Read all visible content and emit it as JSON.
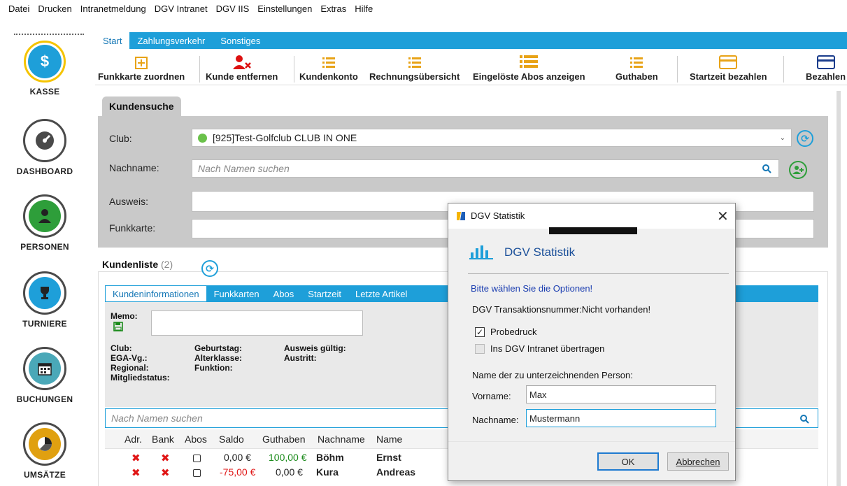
{
  "menu": [
    "Datei",
    "Drucken",
    "Intranetmeldung",
    "DGV Intranet",
    "DGV IIS",
    "Einstellungen",
    "Extras",
    "Hilfe"
  ],
  "sidebar": [
    {
      "label": "KASSE",
      "icon": "dollar-icon",
      "symbol": "$",
      "color": "#1e9fd9",
      "ring": "#f5c400"
    },
    {
      "label": "DASHBOARD",
      "icon": "dashboard-gauge-icon",
      "symbol": "◕",
      "color": "#4a4a4a",
      "ring": "#4a4a4a"
    },
    {
      "label": "PERSONEN",
      "icon": "person-icon",
      "symbol": "●",
      "color": "#2e9e3a",
      "ring": "#4a4a4a"
    },
    {
      "label": "TURNIERE",
      "icon": "trophy-icon",
      "symbol": "🏆",
      "color": "#1e9fd9",
      "ring": "#4a4a4a"
    },
    {
      "label": "BUCHUNGEN",
      "icon": "calendar-icon",
      "symbol": "▦",
      "color": "#4aa8b8",
      "ring": "#4a4a4a"
    },
    {
      "label": "UMSÄTZE",
      "icon": "pie-chart-icon",
      "symbol": "◔",
      "color": "#e0a010",
      "ring": "#4a4a4a"
    }
  ],
  "tabs": [
    "Start",
    "Zahlungsverkehr",
    "Sonstiges"
  ],
  "toolbar": [
    {
      "label": "Funkkarte zuordnen",
      "icon": "plus-box-icon"
    },
    {
      "label": "Kunde entfernen",
      "icon": "remove-user-icon"
    },
    {
      "label": "Kundenkonto",
      "icon": "list-icon"
    },
    {
      "label": "Rechnungsübersicht",
      "icon": "list-icon"
    },
    {
      "label": "Eingelöste Abos anzeigen",
      "icon": "list-icon"
    },
    {
      "label": "Guthaben",
      "icon": "list-icon"
    },
    {
      "label": "Startzeit bezahlen",
      "icon": "card-icon"
    },
    {
      "label": "Bezahlen",
      "icon": "card-icon"
    }
  ],
  "kundensuche": {
    "title": "Kundensuche",
    "club_label": "Club:",
    "club_value": "[925]Test-Golfclub CLUB IN ONE",
    "nachname_label": "Nachname:",
    "nachname_placeholder": "Nach Namen suchen",
    "ausweis_label": "Ausweis:",
    "funkkarte_label": "Funkkarte:"
  },
  "kundenliste": {
    "title": "Kundenliste",
    "count": "(2)",
    "subtabs": [
      "Kundeninformationen",
      "Funkkarten",
      "Abos",
      "Startzeit",
      "Letzte Artikel"
    ],
    "memo_label": "Memo:",
    "fields": {
      "club": "Club:",
      "ega": "EGA-Vg.:",
      "regional": "Regional:",
      "mitglied": "Mitgliedstatus:",
      "geburtstag": "Geburtstag:",
      "alterklasse": "Alterklasse:",
      "funktion": "Funktion:",
      "ausweis": "Ausweis gültig:",
      "austritt": "Austritt:"
    },
    "search_placeholder": "Nach Namen suchen",
    "columns": [
      "Adr.",
      "Bank",
      "Abos",
      "Saldo",
      "Guthaben",
      "Nachname",
      "Name"
    ],
    "rows": [
      {
        "saldo": "0,00 €",
        "guthaben": "100,00 €",
        "nachname": "Böhm",
        "name": "Ernst"
      },
      {
        "saldo": "-75,00 €",
        "guthaben": "0,00 €",
        "nachname": "Kura",
        "name": "Andreas"
      }
    ]
  },
  "dialog": {
    "window_title": "DGV Statistik",
    "heading": "DGV Statistik",
    "info": "Bitte wählen Sie die Optionen!",
    "transaction": "DGV Transaktionsnummer:Nicht vorhanden!",
    "opt1": "Probedruck",
    "opt2": "Ins DGV Intranet übertragen",
    "person_label": "Name der zu unterzeichnenden Person:",
    "vorname_label": "Vorname:",
    "vorname_value": "Max",
    "nachname_label": "Nachname:",
    "nachname_value": "Mustermann",
    "ok": "OK",
    "cancel": "Abbrechen"
  },
  "colors": {
    "accent": "#1e9fd9",
    "red": "#e01616",
    "green": "#1a8a1a",
    "darkblue": "#1a4f99"
  }
}
